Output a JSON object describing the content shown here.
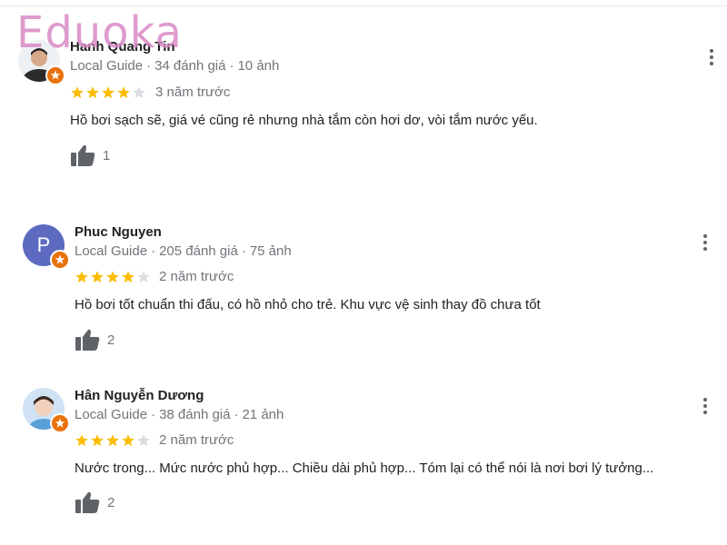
{
  "watermark": "Eduoka",
  "reviews": [
    {
      "name": "Hanh Quang Tin",
      "guide": "Local Guide",
      "review_count": "34 đánh giá",
      "photo_count": "10 ảnh",
      "rating": 4,
      "time": "3 năm trước",
      "text": "Hồ bơi sạch sẽ, giá vé cũng rẻ nhưng nhà tắm còn hơi dơ, vòi tắm nước yếu.",
      "likes": "1",
      "avatar": "photo"
    },
    {
      "name": "Phuc Nguyen",
      "guide": "Local Guide",
      "review_count": "205 đánh giá",
      "photo_count": "75 ảnh",
      "rating": 4,
      "time": "2 năm trước",
      "text": "Hồ bơi tốt chuẩn thi đấu, có hồ nhỏ cho trẻ. Khu vực vệ sinh thay đồ chưa tốt",
      "likes": "2",
      "avatar_letter": "P",
      "avatar_color": "#5c6bc0"
    },
    {
      "name": "Hân Nguyễn Dương",
      "guide": "Local Guide",
      "review_count": "38 đánh giá",
      "photo_count": "21 ảnh",
      "rating": 4,
      "time": "2 năm trước",
      "text": "Nước trong... Mức nước phủ hợp... Chiều dài phủ hợp... Tóm lại có thể nói là nơi bơi lý tưởng...",
      "likes": "2",
      "avatar": "photo"
    }
  ],
  "colors": {
    "star_filled": "#fbbc04",
    "star_empty": "#dadce0",
    "badge": "#e8710a",
    "watermark": "#d98ac6"
  },
  "icons": {
    "like": "thumbs-up-icon",
    "more": "more-vert-icon",
    "badge": "local-guide-badge-icon",
    "star": "star-icon"
  }
}
